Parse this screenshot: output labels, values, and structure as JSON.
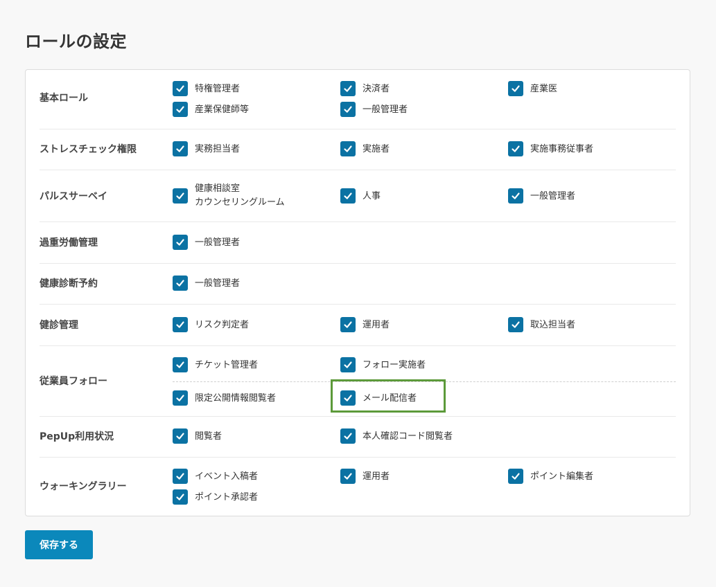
{
  "page": {
    "title": "ロールの設定"
  },
  "rows": [
    {
      "label": "基本ロール",
      "options": [
        {
          "label": "特権管理者",
          "checked": true
        },
        {
          "label": "決済者",
          "checked": true
        },
        {
          "label": "産業医",
          "checked": true
        },
        {
          "label": "産業保健師等",
          "checked": true
        },
        {
          "label": "一般管理者",
          "checked": true
        }
      ]
    },
    {
      "label": "ストレスチェック権限",
      "options": [
        {
          "label": "実務担当者",
          "checked": true
        },
        {
          "label": "実施者",
          "checked": true
        },
        {
          "label": "実施事務従事者",
          "checked": true
        }
      ]
    },
    {
      "label": "パルスサーベイ",
      "options": [
        {
          "label_line1": "健康相談室",
          "label_line2": "カウンセリングルーム",
          "checked": true
        },
        {
          "label": "人事",
          "checked": true
        },
        {
          "label": "一般管理者",
          "checked": true
        }
      ]
    },
    {
      "label": "過重労働管理",
      "options": [
        {
          "label": "一般管理者",
          "checked": true
        }
      ]
    },
    {
      "label": "健康診断予約",
      "options": [
        {
          "label": "一般管理者",
          "checked": true
        }
      ]
    },
    {
      "label": "健診管理",
      "options": [
        {
          "label": "リスク判定者",
          "checked": true
        },
        {
          "label": "運用者",
          "checked": true
        },
        {
          "label": "取込担当者",
          "checked": true
        }
      ]
    },
    {
      "label": "従業員フォロー",
      "options": [
        {
          "label": "チケット管理者",
          "checked": true
        },
        {
          "label": "フォロー実施者",
          "checked": true
        },
        {
          "label": "限定公開情報閲覧者",
          "checked": true
        },
        {
          "label": "メール配信者",
          "checked": true
        }
      ]
    },
    {
      "label": "PepUp利用状況",
      "options": [
        {
          "label": "閲覧者",
          "checked": true
        },
        {
          "label": "本人確認コード閲覧者",
          "checked": true
        }
      ]
    },
    {
      "label": "ウォーキングラリー",
      "options": [
        {
          "label": "イベント入稿者",
          "checked": true
        },
        {
          "label": "運用者",
          "checked": true
        },
        {
          "label": "ポイント編集者",
          "checked": true
        },
        {
          "label": "ポイント承認者",
          "checked": true
        }
      ]
    }
  ],
  "actions": {
    "save_label": "保存する"
  },
  "colors": {
    "checkbox": "#0b72a3",
    "button": "#0b88bb",
    "highlight": "#5c9a3a"
  },
  "icons": {
    "checkbox_mark": "check-icon"
  }
}
